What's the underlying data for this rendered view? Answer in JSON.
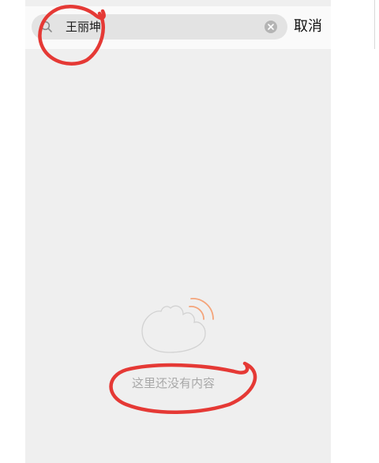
{
  "search": {
    "query": "王丽坤",
    "cancel_label": "取消"
  },
  "empty_state": {
    "message": "这里还没有内容"
  },
  "icons": {
    "search": "search-icon",
    "clear": "clear-icon",
    "empty": "empty-illustration-icon"
  },
  "colors": {
    "annotation": "#e53935",
    "background": "#efefef",
    "search_box": "#e3e3e3",
    "empty_text": "#a8a8a8",
    "illustration_accent": "#f4a47a"
  }
}
